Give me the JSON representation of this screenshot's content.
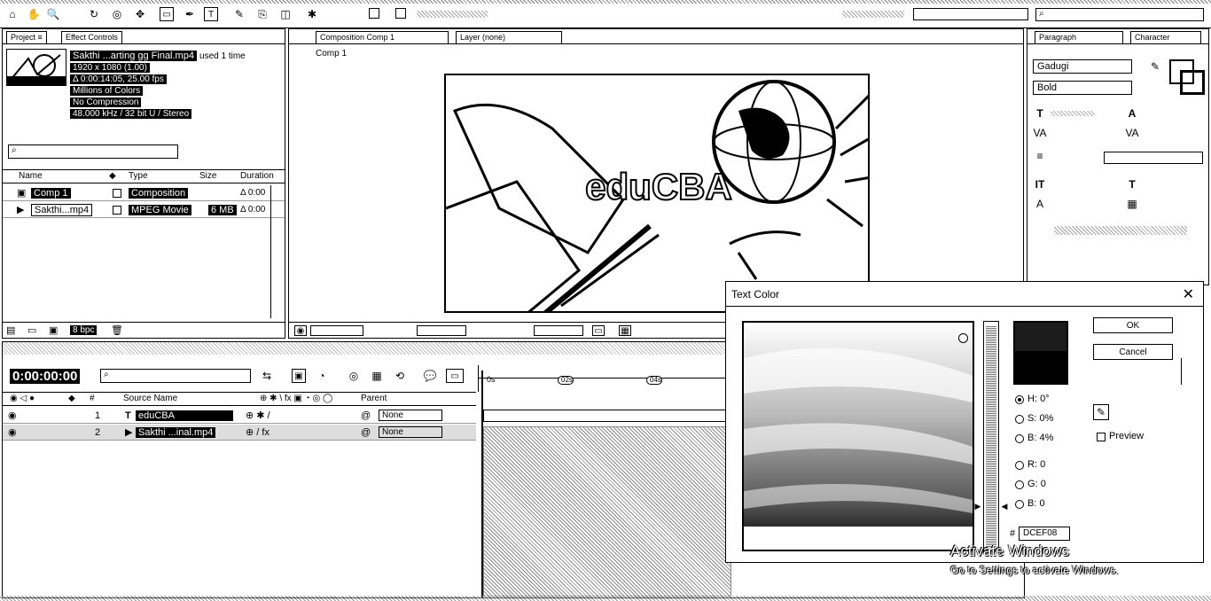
{
  "project": {
    "item_name": "Sakthi ...arting gg Final.mp4",
    "usage": "used 1 time",
    "resolution": "1920 x 1080 (1.00)",
    "duration": "Δ 0:00:14:05, 25.00 fps",
    "colors": "Millions of Colors",
    "compression": "No Compression",
    "audio": "48.000 kHz / 32 bit U / Stereo",
    "search_placeholder": "",
    "columns": [
      "Name",
      "Type",
      "Size",
      "Duration"
    ],
    "rows": [
      {
        "name": "Comp 1",
        "type": "Composition",
        "size": "",
        "duration": "Δ 0:00"
      },
      {
        "name": "Sakthi...mp4",
        "type": "MPEG Movie",
        "size": "6 MB",
        "duration": "Δ 0:00"
      }
    ],
    "bpc": "8 bpc"
  },
  "viewer": {
    "tab_label": "Composition Comp 1",
    "tab2_label": "Layer (none)",
    "sub_label": "Comp 1",
    "logo_text": "eduCBA"
  },
  "character": {
    "tabs": [
      "Paragraph",
      "Character"
    ],
    "font_family": "Gadugi",
    "font_style": "Bold"
  },
  "timeline": {
    "timecode": "0:00:00:00",
    "search_placeholder": "",
    "column_source": "Source Name",
    "column_parent": "Parent",
    "layers": [
      {
        "num": "1",
        "name": "eduCBA",
        "parent": "None"
      },
      {
        "num": "2",
        "name": "Sakthi ...inal.mp4",
        "parent": "None"
      }
    ],
    "ruler_marks": [
      "0s",
      "02s",
      "04s"
    ]
  },
  "dialog": {
    "title": "Text Color",
    "ok": "OK",
    "cancel": "Cancel",
    "radios": [
      {
        "label": "H:",
        "value": "0°",
        "selected": true
      },
      {
        "label": "S:",
        "value": "0%",
        "selected": false
      },
      {
        "label": "B:",
        "value": "4%",
        "selected": false
      },
      {
        "label": "R:",
        "value": "0",
        "selected": false
      },
      {
        "label": "G:",
        "value": "0",
        "selected": false
      },
      {
        "label": "B:",
        "value": "0",
        "selected": false
      }
    ],
    "preview_label": "Preview",
    "hex_value": "DCEF08",
    "new_color": "#1c1c1c",
    "old_color": "#000000"
  },
  "watermark": {
    "line1": "Activate Windows",
    "line2": "Go to Settings to activate Windows."
  }
}
